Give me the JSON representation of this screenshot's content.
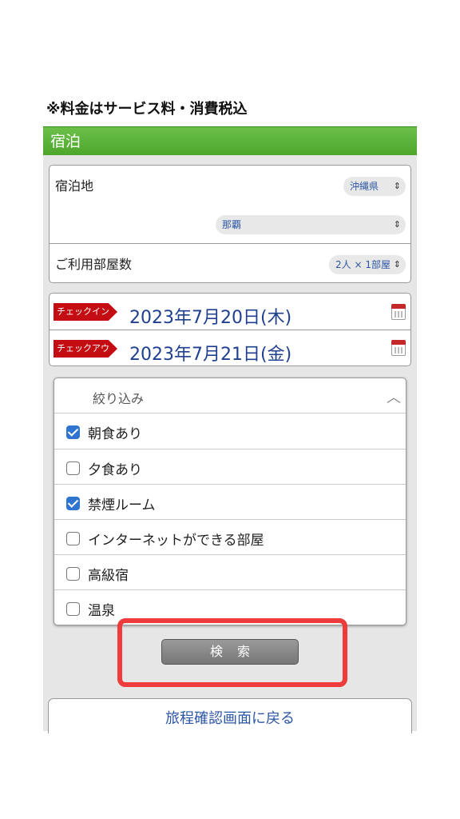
{
  "notice": "※料金はサービス料・消費税込",
  "section_title": "宿泊",
  "location": {
    "label": "宿泊地",
    "prefecture": "沖縄県",
    "city": "那覇"
  },
  "rooms": {
    "label": "ご利用部屋数",
    "value": "2人 × 1部屋"
  },
  "checkin": {
    "tag": "チェックイン",
    "date": "2023年7月20日(木)"
  },
  "checkout": {
    "tag": "チェックアウト",
    "date": "2023年7月21日(金)"
  },
  "filter": {
    "title": "絞り込み",
    "options": [
      {
        "label": "朝食あり",
        "checked": true
      },
      {
        "label": "夕食あり",
        "checked": false
      },
      {
        "label": "禁煙ルーム",
        "checked": true
      },
      {
        "label": "インターネットができる部屋",
        "checked": false
      },
      {
        "label": "高級宿",
        "checked": false
      },
      {
        "label": "温泉",
        "checked": false
      }
    ]
  },
  "search_button": "検索",
  "back_button": "旅程確認画面に戻る",
  "colors": {
    "header_green": "#4da62c",
    "tag_red": "#c40d12",
    "link_blue": "#2d56a5",
    "checkbox_blue": "#2f74d0",
    "highlight_red": "#ee3b3b"
  }
}
